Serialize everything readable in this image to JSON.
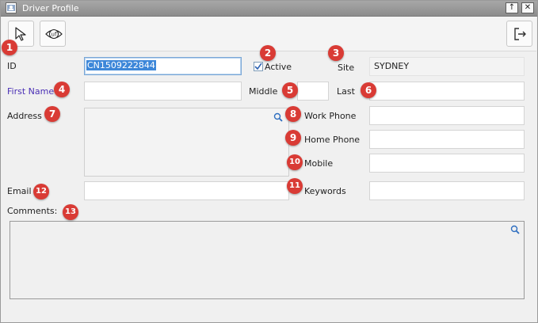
{
  "window": {
    "title": "Driver Profile",
    "restore_glyph": "↑",
    "close_glyph": "✕"
  },
  "toolbar": {
    "pointer_icon": "cursor-arrow-icon",
    "uf_icon": "uf-eye-icon",
    "uf_text": "uf",
    "exit_icon": "exit-door-icon"
  },
  "form": {
    "id_label": "ID",
    "id_value": "CN1509222844",
    "active_label": "Active",
    "active_checked": true,
    "site_label": "Site",
    "site_value": "SYDNEY",
    "first_name_label": "First Name",
    "first_name_value": "",
    "middle_label": "Middle",
    "middle_value": "",
    "last_label": "Last",
    "last_value": "",
    "address_label": "Address",
    "address_value": "",
    "work_phone_label": "Work Phone",
    "work_phone_value": "",
    "home_phone_label": "Home Phone",
    "home_phone_value": "",
    "mobile_label": "Mobile",
    "mobile_value": "",
    "email_label": "Email",
    "email_value": "",
    "keywords_label": "Keywords",
    "keywords_value": "",
    "comments_label": "Comments:",
    "comments_value": ""
  },
  "badges": [
    "1",
    "2",
    "3",
    "4",
    "5",
    "6",
    "7",
    "8",
    "9",
    "10",
    "11",
    "12",
    "13"
  ],
  "colors": {
    "badge": "#d93b35",
    "selection": "#3d87d9",
    "link_label": "#4a2fb5",
    "titlebar": "#999999"
  }
}
